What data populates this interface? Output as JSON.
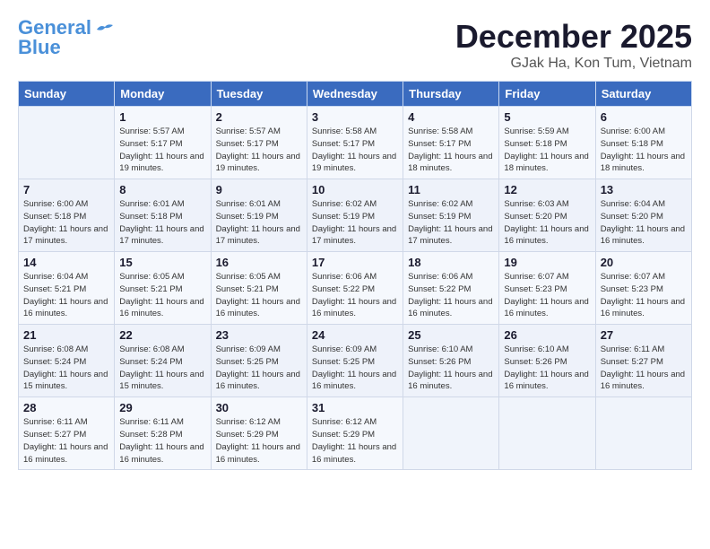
{
  "header": {
    "logo_general": "General",
    "logo_blue": "Blue",
    "month_year": "December 2025",
    "location": "GJak Ha, Kon Tum, Vietnam"
  },
  "weekdays": [
    "Sunday",
    "Monday",
    "Tuesday",
    "Wednesday",
    "Thursday",
    "Friday",
    "Saturday"
  ],
  "weeks": [
    [
      {
        "day": "",
        "info": ""
      },
      {
        "day": "1",
        "info": "Sunrise: 5:57 AM\nSunset: 5:17 PM\nDaylight: 11 hours\nand 19 minutes."
      },
      {
        "day": "2",
        "info": "Sunrise: 5:57 AM\nSunset: 5:17 PM\nDaylight: 11 hours\nand 19 minutes."
      },
      {
        "day": "3",
        "info": "Sunrise: 5:58 AM\nSunset: 5:17 PM\nDaylight: 11 hours\nand 19 minutes."
      },
      {
        "day": "4",
        "info": "Sunrise: 5:58 AM\nSunset: 5:17 PM\nDaylight: 11 hours\nand 18 minutes."
      },
      {
        "day": "5",
        "info": "Sunrise: 5:59 AM\nSunset: 5:18 PM\nDaylight: 11 hours\nand 18 minutes."
      },
      {
        "day": "6",
        "info": "Sunrise: 6:00 AM\nSunset: 5:18 PM\nDaylight: 11 hours\nand 18 minutes."
      }
    ],
    [
      {
        "day": "7",
        "info": "Sunrise: 6:00 AM\nSunset: 5:18 PM\nDaylight: 11 hours\nand 17 minutes."
      },
      {
        "day": "8",
        "info": "Sunrise: 6:01 AM\nSunset: 5:18 PM\nDaylight: 11 hours\nand 17 minutes."
      },
      {
        "day": "9",
        "info": "Sunrise: 6:01 AM\nSunset: 5:19 PM\nDaylight: 11 hours\nand 17 minutes."
      },
      {
        "day": "10",
        "info": "Sunrise: 6:02 AM\nSunset: 5:19 PM\nDaylight: 11 hours\nand 17 minutes."
      },
      {
        "day": "11",
        "info": "Sunrise: 6:02 AM\nSunset: 5:19 PM\nDaylight: 11 hours\nand 17 minutes."
      },
      {
        "day": "12",
        "info": "Sunrise: 6:03 AM\nSunset: 5:20 PM\nDaylight: 11 hours\nand 16 minutes."
      },
      {
        "day": "13",
        "info": "Sunrise: 6:04 AM\nSunset: 5:20 PM\nDaylight: 11 hours\nand 16 minutes."
      }
    ],
    [
      {
        "day": "14",
        "info": "Sunrise: 6:04 AM\nSunset: 5:21 PM\nDaylight: 11 hours\nand 16 minutes."
      },
      {
        "day": "15",
        "info": "Sunrise: 6:05 AM\nSunset: 5:21 PM\nDaylight: 11 hours\nand 16 minutes."
      },
      {
        "day": "16",
        "info": "Sunrise: 6:05 AM\nSunset: 5:21 PM\nDaylight: 11 hours\nand 16 minutes."
      },
      {
        "day": "17",
        "info": "Sunrise: 6:06 AM\nSunset: 5:22 PM\nDaylight: 11 hours\nand 16 minutes."
      },
      {
        "day": "18",
        "info": "Sunrise: 6:06 AM\nSunset: 5:22 PM\nDaylight: 11 hours\nand 16 minutes."
      },
      {
        "day": "19",
        "info": "Sunrise: 6:07 AM\nSunset: 5:23 PM\nDaylight: 11 hours\nand 16 minutes."
      },
      {
        "day": "20",
        "info": "Sunrise: 6:07 AM\nSunset: 5:23 PM\nDaylight: 11 hours\nand 16 minutes."
      }
    ],
    [
      {
        "day": "21",
        "info": "Sunrise: 6:08 AM\nSunset: 5:24 PM\nDaylight: 11 hours\nand 15 minutes."
      },
      {
        "day": "22",
        "info": "Sunrise: 6:08 AM\nSunset: 5:24 PM\nDaylight: 11 hours\nand 15 minutes."
      },
      {
        "day": "23",
        "info": "Sunrise: 6:09 AM\nSunset: 5:25 PM\nDaylight: 11 hours\nand 16 minutes."
      },
      {
        "day": "24",
        "info": "Sunrise: 6:09 AM\nSunset: 5:25 PM\nDaylight: 11 hours\nand 16 minutes."
      },
      {
        "day": "25",
        "info": "Sunrise: 6:10 AM\nSunset: 5:26 PM\nDaylight: 11 hours\nand 16 minutes."
      },
      {
        "day": "26",
        "info": "Sunrise: 6:10 AM\nSunset: 5:26 PM\nDaylight: 11 hours\nand 16 minutes."
      },
      {
        "day": "27",
        "info": "Sunrise: 6:11 AM\nSunset: 5:27 PM\nDaylight: 11 hours\nand 16 minutes."
      }
    ],
    [
      {
        "day": "28",
        "info": "Sunrise: 6:11 AM\nSunset: 5:27 PM\nDaylight: 11 hours\nand 16 minutes."
      },
      {
        "day": "29",
        "info": "Sunrise: 6:11 AM\nSunset: 5:28 PM\nDaylight: 11 hours\nand 16 minutes."
      },
      {
        "day": "30",
        "info": "Sunrise: 6:12 AM\nSunset: 5:29 PM\nDaylight: 11 hours\nand 16 minutes."
      },
      {
        "day": "31",
        "info": "Sunrise: 6:12 AM\nSunset: 5:29 PM\nDaylight: 11 hours\nand 16 minutes."
      },
      {
        "day": "",
        "info": ""
      },
      {
        "day": "",
        "info": ""
      },
      {
        "day": "",
        "info": ""
      }
    ]
  ]
}
